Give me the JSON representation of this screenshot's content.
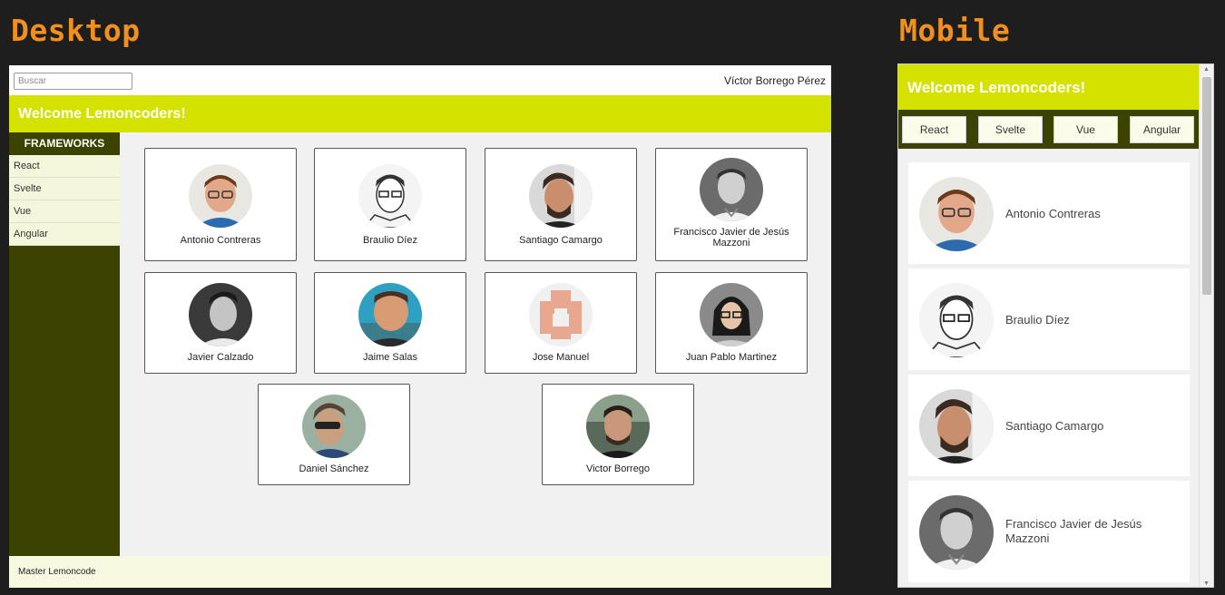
{
  "labels": {
    "desktop": "Desktop",
    "mobile": "Mobile"
  },
  "desktop": {
    "search_placeholder": "Buscar",
    "user_name": "Víctor Borrego Pérez",
    "banner_title": "Welcome Lemoncoders!",
    "sidebar": {
      "heading": "FRAMEWORKS",
      "items": [
        {
          "label": "React"
        },
        {
          "label": "Svelte"
        },
        {
          "label": "Vue"
        },
        {
          "label": "Angular"
        }
      ]
    },
    "members": [
      {
        "name": "Antonio Contreras"
      },
      {
        "name": "Braulio Díez"
      },
      {
        "name": "Santiago Camargo"
      },
      {
        "name": "Francisco Javier de Jesús Mazzoni"
      },
      {
        "name": "Javier Calzado"
      },
      {
        "name": "Jaime Salas"
      },
      {
        "name": "Jose Manuel"
      },
      {
        "name": "Juan Pablo Martinez"
      },
      {
        "name": "Daniel Sánchez"
      },
      {
        "name": "Victor Borrego"
      }
    ],
    "footer": "Master Lemoncode"
  },
  "mobile": {
    "banner_title": "Welcome Lemoncoders!",
    "nav": [
      {
        "label": "React"
      },
      {
        "label": "Svelte"
      },
      {
        "label": "Vue"
      },
      {
        "label": "Angular"
      }
    ],
    "members": [
      {
        "name": "Antonio Contreras"
      },
      {
        "name": "Braulio Díez"
      },
      {
        "name": "Santiago Camargo"
      },
      {
        "name": "Francisco Javier de Jesús Mazzoni"
      }
    ]
  },
  "colors": {
    "title_orange": "#f2901d",
    "lime": "#d5e200",
    "olive": "#3c4200",
    "cream": "#f5f7dd",
    "background": "#1e1e1e"
  }
}
